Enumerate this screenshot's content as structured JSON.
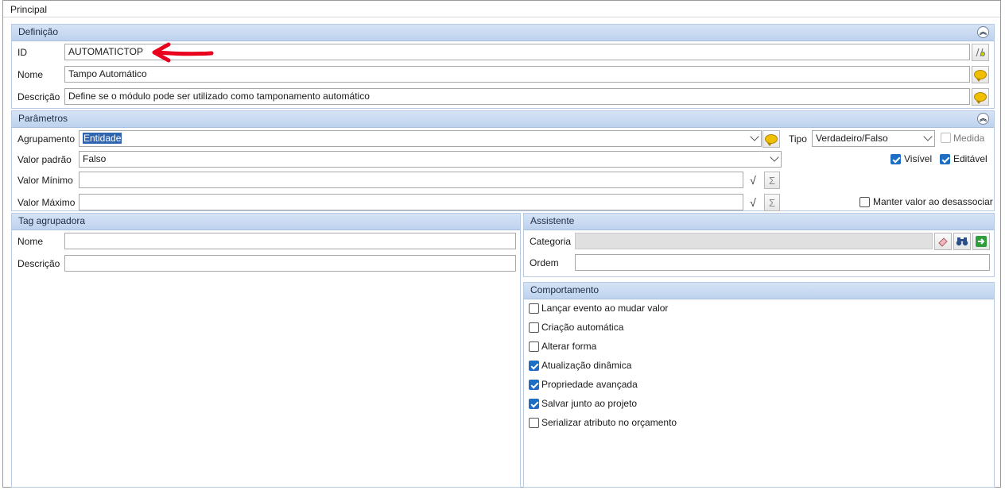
{
  "tab": {
    "title": "Principal"
  },
  "definicao": {
    "title": "Definição",
    "collapse_icon": "chevrons-up-icon",
    "id_label": "ID",
    "id_value": "AUTOMATICTOP",
    "nome_label": "Nome",
    "nome_value": "Tampo Automático",
    "descricao_label": "Descrição",
    "descricao_value": "Define se o módulo pode ser utilizado como tamponamento automático"
  },
  "parametros": {
    "title": "Parâmetros",
    "agrupamento_label": "Agrupamento",
    "agrupamento_value": "Entidade",
    "valor_padrao_label": "Valor padrão",
    "valor_padrao_value": "Falso",
    "valor_minimo_label": "Valor Mínimo",
    "valor_maximo_label": "Valor Máximo",
    "tipo_label": "Tipo",
    "tipo_value": "Verdadeiro/Falso",
    "medida_label": "Medida",
    "medida_checked": false,
    "visivel_label": "Visível",
    "visivel_checked": true,
    "editavel_label": "Editável",
    "editavel_checked": true,
    "manter_label": "Manter valor ao desassociar",
    "manter_checked": false,
    "sigma": "Σ",
    "sqrt": "√"
  },
  "tag": {
    "title": "Tag agrupadora",
    "nome_label": "Nome",
    "nome_value": "",
    "descricao_label": "Descrição",
    "descricao_value": ""
  },
  "assistente": {
    "title": "Assistente",
    "categoria_label": "Categoria",
    "ordem_label": "Ordem"
  },
  "comportamento": {
    "title": "Comportamento",
    "items": [
      {
        "label": "Lançar evento ao mudar valor",
        "checked": false
      },
      {
        "label": "Criação automática",
        "checked": false
      },
      {
        "label": "Alterar forma",
        "checked": false
      },
      {
        "label": "Atualização dinâmica",
        "checked": true
      },
      {
        "label": "Propriedade avançada",
        "checked": true
      },
      {
        "label": "Salvar junto ao projeto",
        "checked": true
      },
      {
        "label": "Serializar atributo no orçamento",
        "checked": false
      }
    ]
  },
  "colors": {
    "accent": "#1e6fc4",
    "annotation_arrow": "#e8001c",
    "panel_header": "#c6d8f0"
  }
}
